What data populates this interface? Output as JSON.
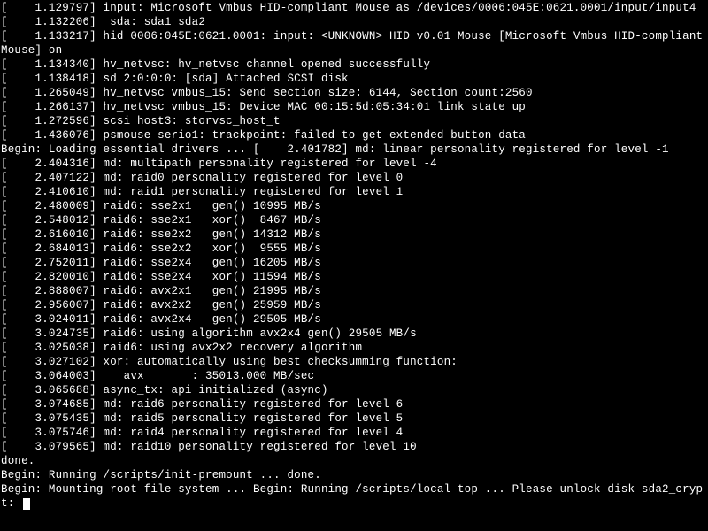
{
  "boot": {
    "lines": [
      "[    1.129797] input: Microsoft Vmbus HID-compliant Mouse as /devices/0006:045E:0621.0001/input/input4",
      "[    1.132206]  sda: sda1 sda2",
      "[    1.133217] hid 0006:045E:0621.0001: input: <UNKNOWN> HID v0.01 Mouse [Microsoft Vmbus HID-compliant Mouse] on ",
      "[    1.134340] hv_netvsc: hv_netvsc channel opened successfully",
      "[    1.138418] sd 2:0:0:0: [sda] Attached SCSI disk",
      "[    1.265049] hv_netvsc vmbus_15: Send section size: 6144, Section count:2560",
      "[    1.266137] hv_netvsc vmbus_15: Device MAC 00:15:5d:05:34:01 link state up",
      "[    1.272596] scsi host3: storvsc_host_t",
      "[    1.436076] psmouse serio1: trackpoint: failed to get extended button data",
      "Begin: Loading essential drivers ... [    2.401782] md: linear personality registered for level -1",
      "[    2.404316] md: multipath personality registered for level -4",
      "[    2.407122] md: raid0 personality registered for level 0",
      "[    2.410610] md: raid1 personality registered for level 1",
      "[    2.480009] raid6: sse2x1   gen() 10995 MB/s",
      "[    2.548012] raid6: sse2x1   xor()  8467 MB/s",
      "[    2.616010] raid6: sse2x2   gen() 14312 MB/s",
      "[    2.684013] raid6: sse2x2   xor()  9555 MB/s",
      "[    2.752011] raid6: sse2x4   gen() 16205 MB/s",
      "[    2.820010] raid6: sse2x4   xor() 11594 MB/s",
      "[    2.888007] raid6: avx2x1   gen() 21995 MB/s",
      "[    2.956007] raid6: avx2x2   gen() 25959 MB/s",
      "[    3.024011] raid6: avx2x4   gen() 29505 MB/s",
      "[    3.024735] raid6: using algorithm avx2x4 gen() 29505 MB/s",
      "[    3.025038] raid6: using avx2x2 recovery algorithm",
      "[    3.027102] xor: automatically using best checksumming function:",
      "[    3.064003]    avx       : 35013.000 MB/sec",
      "[    3.065688] async_tx: api initialized (async)",
      "[    3.074685] md: raid6 personality registered for level 6",
      "[    3.075435] md: raid5 personality registered for level 5",
      "[    3.075746] md: raid4 personality registered for level 4",
      "[    3.079565] md: raid10 personality registered for level 10",
      "done.",
      "Begin: Running /scripts/init-premount ... done.",
      "Begin: Mounting root file system ... Begin: Running /scripts/local-top ... Please unlock disk sda2_crypt: "
    ]
  }
}
